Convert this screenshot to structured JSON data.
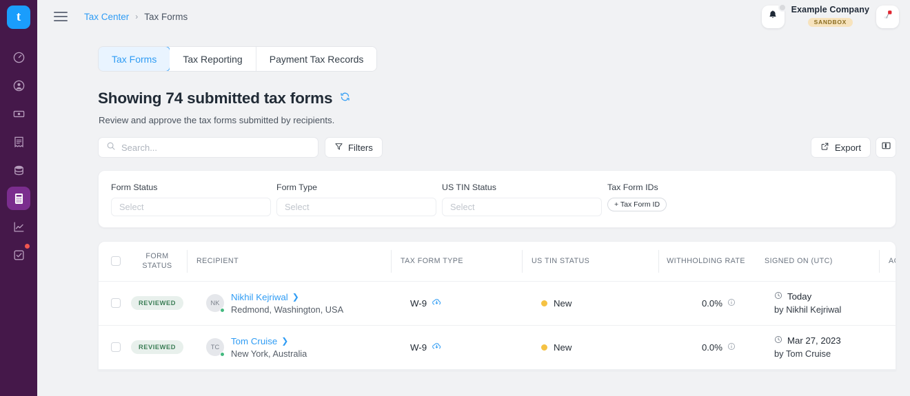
{
  "rail": {
    "logo_letter": "t",
    "items": [
      {
        "name": "dashboard",
        "icon": "gauge-icon",
        "active": false,
        "badge": false
      },
      {
        "name": "recipients",
        "icon": "user-circle-icon",
        "active": false,
        "badge": false
      },
      {
        "name": "payments",
        "icon": "money-icon",
        "active": false,
        "badge": false
      },
      {
        "name": "invoices",
        "icon": "receipt-icon",
        "active": false,
        "badge": false
      },
      {
        "name": "data",
        "icon": "database-icon",
        "active": false,
        "badge": false
      },
      {
        "name": "tax-center",
        "icon": "calculator-icon",
        "active": true,
        "badge": false
      },
      {
        "name": "reports",
        "icon": "line-chart-icon",
        "active": false,
        "badge": false
      },
      {
        "name": "tasks",
        "icon": "checkbox-icon",
        "active": false,
        "badge": true
      }
    ]
  },
  "topbar": {
    "menu_icon": "hamburger-icon",
    "breadcrumb": {
      "root": "Tax Center",
      "separator": "›",
      "current": "Tax Forms"
    },
    "notifications_icon": "bell-icon",
    "company_name": "Example Company",
    "environment_badge": "SANDBOX",
    "account_icon": "pin-avatar-icon"
  },
  "tabs": [
    {
      "label": "Tax Forms",
      "active": true
    },
    {
      "label": "Tax Reporting",
      "active": false
    },
    {
      "label": "Payment Tax Records",
      "active": false
    }
  ],
  "page": {
    "title": "Showing 74 submitted tax forms",
    "refresh_icon": "refresh-icon",
    "subtitle": "Review and approve the tax forms submitted by recipients."
  },
  "toolbar": {
    "search_placeholder": "Search...",
    "search_value": "",
    "search_icon": "search-icon",
    "filters_label": "Filters",
    "filters_icon": "funnel-icon",
    "export_label": "Export",
    "export_icon": "external-link-icon",
    "columns_icon": "columns-icon"
  },
  "filters": {
    "form_status": {
      "label": "Form Status",
      "placeholder": "Select",
      "value": ""
    },
    "form_type": {
      "label": "Form Type",
      "placeholder": "Select",
      "value": ""
    },
    "us_tin_status": {
      "label": "US TIN Status",
      "placeholder": "Select",
      "value": ""
    },
    "tax_form_ids": {
      "label": "Tax Form IDs",
      "add_button": "+ Tax Form ID"
    }
  },
  "table": {
    "columns": [
      {
        "key": "check",
        "label": ""
      },
      {
        "key": "status",
        "label_line1": "FORM",
        "label_line2": "STATUS"
      },
      {
        "key": "recipient",
        "label": "RECIPIENT"
      },
      {
        "key": "type",
        "label": "TAX FORM TYPE"
      },
      {
        "key": "tin",
        "label": "US TIN STATUS"
      },
      {
        "key": "rate",
        "label": "WITHHOLDING RATE"
      },
      {
        "key": "signed",
        "label": "SIGNED ON (UTC)"
      },
      {
        "key": "actions",
        "label": "ACTIONS",
        "help_icon": "help-icon"
      }
    ],
    "rows": [
      {
        "status": "REVIEWED",
        "initials": "NK",
        "name": "Nikhil Kejriwal",
        "location": "Redmond, Washington, USA",
        "form_type": "W-9",
        "download_icon": "cloud-download-icon",
        "tin_status": "New",
        "tin_color": "#f5c243",
        "withholding_rate": "0.0%",
        "rate_info_icon": "info-icon",
        "signed_on": "Today",
        "signed_by": "by Nikhil Kejriwal",
        "clock_icon": "clock-icon",
        "actions_icon": "more-dots-icon"
      },
      {
        "status": "REVIEWED",
        "initials": "TC",
        "name": "Tom Cruise",
        "location": "New York, Australia",
        "form_type": "W-9",
        "download_icon": "cloud-download-icon",
        "tin_status": "New",
        "tin_color": "#f5c243",
        "withholding_rate": "0.0%",
        "rate_info_icon": "info-icon",
        "signed_on": "Mar 27, 2023",
        "signed_by": "by Tom Cruise",
        "clock_icon": "clock-icon",
        "actions_icon": "more-dots-icon"
      }
    ]
  },
  "colors": {
    "rail_bg": "#45184a",
    "rail_active": "#7b2d8e",
    "accent_blue": "#2f9cf4",
    "logo_blue": "#1a9dfc",
    "badge_green_text": "#3a7d55",
    "badge_green_bg": "#e8f0ec",
    "sandbox_bg": "#f7e3bd",
    "sandbox_text": "#8a6d20",
    "tin_new": "#f5c243"
  }
}
